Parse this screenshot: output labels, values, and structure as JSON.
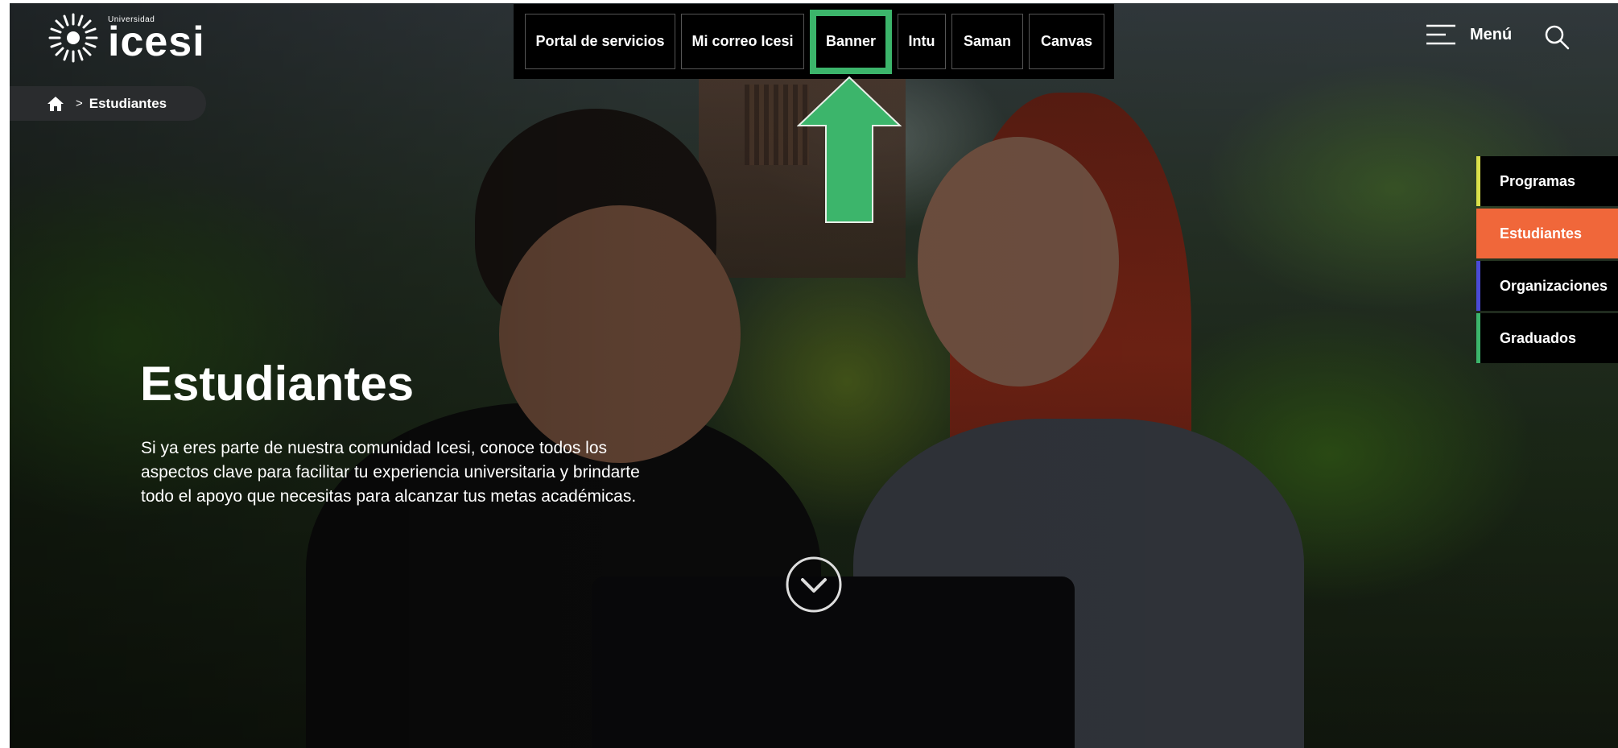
{
  "brand": {
    "small_text": "Universidad",
    "name": "icesi"
  },
  "top_nav": {
    "items": [
      {
        "label": "Portal de servicios"
      },
      {
        "label": "Mi correo Icesi"
      },
      {
        "label": "Banner"
      },
      {
        "label": "Intu"
      },
      {
        "label": "Saman"
      },
      {
        "label": "Canvas"
      }
    ],
    "highlight_color": "#3cb56b"
  },
  "header": {
    "menu_label": "Menú"
  },
  "breadcrumb": {
    "separator": ">",
    "current": "Estudiantes"
  },
  "side_tabs": [
    {
      "label": "Programas",
      "accent": "#d9e04a"
    },
    {
      "label": "Estudiantes",
      "accent": "#f0673a",
      "active": true
    },
    {
      "label": "Organizaciones",
      "accent": "#4a4ad6"
    },
    {
      "label": "Graduados",
      "accent": "#3cb56b"
    }
  ],
  "hero": {
    "title": "Estudiantes",
    "description": "Si ya eres parte de nuestra comunidad Icesi, conoce todos los aspectos clave para facilitar tu experiencia universitaria y brindarte todo el apoyo que necesitas para alcanzar tus metas académicas."
  },
  "icons": {
    "home": "home-icon",
    "search": "search-icon",
    "menu": "hamburger-menu-icon",
    "scroll": "chevron-down-circle-icon",
    "annotation": "up-arrow-annotation"
  }
}
